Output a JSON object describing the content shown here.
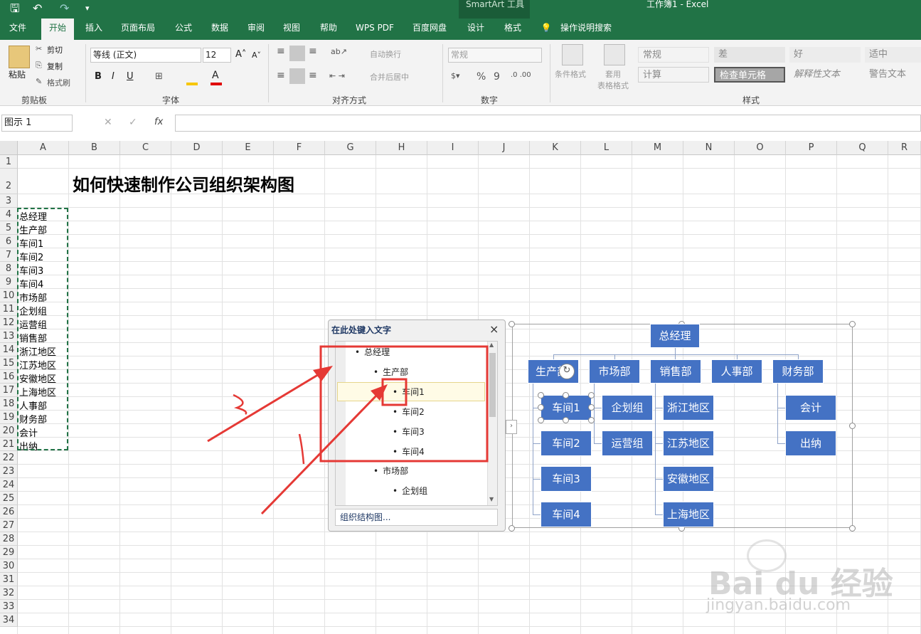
{
  "titlebar": {
    "context_tool": "SmartArt 工具",
    "doc_title": "工作簿1  -  Excel"
  },
  "tabs": [
    {
      "label": "文件"
    },
    {
      "label": "开始"
    },
    {
      "label": "插入"
    },
    {
      "label": "页面布局"
    },
    {
      "label": "公式"
    },
    {
      "label": "数据"
    },
    {
      "label": "审阅"
    },
    {
      "label": "视图"
    },
    {
      "label": "帮助"
    },
    {
      "label": "WPS PDF"
    },
    {
      "label": "百度网盘"
    },
    {
      "label": "设计"
    },
    {
      "label": "格式"
    },
    {
      "label": "操作说明搜索"
    }
  ],
  "ribbon": {
    "clipboard": {
      "paste": "粘贴",
      "cut": "剪切",
      "copy": "复制",
      "format_painter": "格式刷",
      "group": "剪贴板"
    },
    "font": {
      "name": "等线 (正文)",
      "size": "12",
      "bold": "B",
      "italic": "I",
      "underline": "U",
      "group": "字体"
    },
    "alignment": {
      "wrap": "自动换行",
      "merge": "合并后居中",
      "group": "对齐方式"
    },
    "number": {
      "format": "常规",
      "percent": "%",
      "comma": "9",
      "group": "数字"
    },
    "styles": {
      "conditional": "条件格式",
      "table_format": "套用\n表格格式",
      "cells": [
        "常规",
        "差",
        "好",
        "适中",
        "计算",
        "检查单元格",
        "解释性文本",
        "警告文本"
      ],
      "group": "样式"
    }
  },
  "formula_bar": {
    "name_box": "图示 1",
    "fx": "fx",
    "value": ""
  },
  "columns": [
    "A",
    "B",
    "C",
    "D",
    "E",
    "F",
    "G",
    "H",
    "I",
    "J",
    "K",
    "L",
    "M",
    "N",
    "O",
    "P",
    "Q",
    "R"
  ],
  "rows": [
    "1",
    "2",
    "3",
    "4",
    "5",
    "6",
    "7",
    "8",
    "9",
    "10",
    "11",
    "12",
    "13",
    "14",
    "15",
    "16",
    "17",
    "18",
    "19",
    "20",
    "21",
    "22",
    "23",
    "24",
    "25",
    "26",
    "27",
    "28",
    "29",
    "30",
    "31",
    "32",
    "33",
    "34"
  ],
  "sheet_title": "如何快速制作公司组织架构图",
  "column_a": [
    "总经理",
    "生产部",
    "车间1",
    "车间2",
    "车间3",
    "车间4",
    "市场部",
    "企划组",
    "运营组",
    "销售部",
    "浙江地区",
    "江苏地区",
    "安徽地区",
    "上海地区",
    "人事部",
    "财务部",
    "会计",
    "出纳"
  ],
  "text_pane": {
    "title": "在此处键入文字",
    "close": "×",
    "items": [
      "总经理",
      "生产部",
      "车间1",
      "车间2",
      "车间3",
      "车间4",
      "市场部",
      "企划组"
    ],
    "footer": "组织结构图..."
  },
  "orgchart": {
    "root": "总经理",
    "departments": [
      "生产部",
      "市场部",
      "销售部",
      "人事部",
      "财务部"
    ],
    "production": [
      "车间1",
      "车间2",
      "车间3",
      "车间4"
    ],
    "market": [
      "企划组",
      "运营组"
    ],
    "sales": [
      "浙江地区",
      "江苏地区",
      "安徽地区",
      "上海地区"
    ],
    "finance": [
      "会计",
      "出纳"
    ]
  },
  "watermark": {
    "brand": "Bai du 经验",
    "url": "jingyan.baidu.com"
  },
  "colors": {
    "excel_green": "#217346",
    "node_blue": "#4472c4",
    "annotation_red": "#e53935"
  }
}
